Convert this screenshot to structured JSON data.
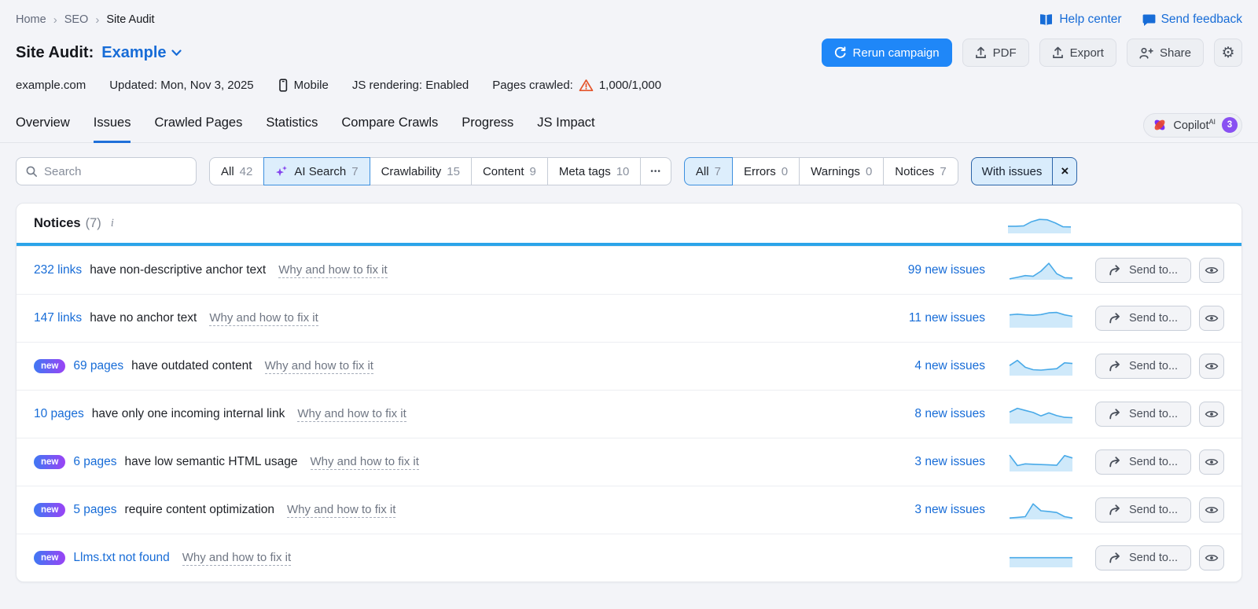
{
  "breadcrumb": {
    "items": [
      "Home",
      "SEO",
      "Site Audit"
    ]
  },
  "header": {
    "help_center": "Help center",
    "send_feedback": "Send feedback",
    "title_prefix": "Site Audit:",
    "campaign_name": "Example",
    "rerun_button": "Rerun campaign",
    "pdf_button": "PDF",
    "export_button": "Export",
    "share_button": "Share"
  },
  "meta": {
    "domain": "example.com",
    "updated": "Updated: Mon, Nov 3, 2025",
    "device": "Mobile",
    "js_rendering": "JS rendering: Enabled",
    "pages_crawled_label": "Pages crawled:",
    "pages_crawled_value": "1,000/1,000"
  },
  "tabs": [
    {
      "label": "Overview",
      "active": false
    },
    {
      "label": "Issues",
      "active": true
    },
    {
      "label": "Crawled Pages",
      "active": false
    },
    {
      "label": "Statistics",
      "active": false
    },
    {
      "label": "Compare Crawls",
      "active": false
    },
    {
      "label": "Progress",
      "active": false
    },
    {
      "label": "JS Impact",
      "active": false
    }
  ],
  "copilot": {
    "label": "Copilot",
    "superscript": "AI",
    "badge": "3"
  },
  "filters": {
    "search_placeholder": "Search",
    "more_label": "•••",
    "category_chips": [
      {
        "label": "All",
        "count": "42",
        "selected": false
      },
      {
        "label": "AI Search",
        "count": "7",
        "selected": true
      },
      {
        "label": "Crawlability",
        "count": "15",
        "selected": false
      },
      {
        "label": "Content",
        "count": "9",
        "selected": false
      },
      {
        "label": "Meta tags",
        "count": "10",
        "selected": false
      }
    ],
    "severity_chips": [
      {
        "label": "All",
        "count": "7",
        "selected": true
      },
      {
        "label": "Errors",
        "count": "0",
        "selected": false
      },
      {
        "label": "Warnings",
        "count": "0",
        "selected": false
      },
      {
        "label": "Notices",
        "count": "7",
        "selected": false
      }
    ],
    "with_issues_label": "With issues",
    "with_issues_close": "×"
  },
  "notices": {
    "title": "Notices",
    "count": "(7)",
    "trend": [
      38,
      38,
      40,
      62,
      74,
      72,
      56,
      35,
      34
    ]
  },
  "row_actions": {
    "send_to": "Send to..."
  },
  "rows": [
    {
      "badge": null,
      "link": "232 links",
      "text": "have non-descriptive anchor text",
      "fix": "Why and how to fix it",
      "issues": "99 new issues",
      "trend": [
        5,
        14,
        24,
        20,
        50,
        95,
        35,
        12,
        10
      ]
    },
    {
      "badge": null,
      "link": "147 links",
      "text": "have no anchor text",
      "fix": "Why and how to fix it",
      "issues": "11 new issues",
      "trend": [
        74,
        78,
        74,
        72,
        76,
        86,
        88,
        74,
        66
      ]
    },
    {
      "badge": "new",
      "link": "69 pages",
      "text": "have outdated content",
      "fix": "Why and how to fix it",
      "issues": "4 new issues",
      "trend": [
        58,
        88,
        48,
        34,
        32,
        36,
        40,
        74,
        70
      ]
    },
    {
      "badge": null,
      "link": "10 pages",
      "text": "have only one incoming internal link",
      "fix": "Why and how to fix it",
      "issues": "8 new issues",
      "trend": [
        66,
        88,
        76,
        64,
        44,
        62,
        46,
        36,
        34
      ]
    },
    {
      "badge": "new",
      "link": "6 pages",
      "text": "have low semantic HTML usage",
      "fix": "Why and how to fix it",
      "issues": "3 new issues",
      "trend": [
        95,
        34,
        44,
        42,
        40,
        38,
        36,
        92,
        78
      ]
    },
    {
      "badge": "new",
      "link": "5 pages",
      "text": "require content optimization",
      "fix": "Why and how to fix it",
      "issues": "3 new issues",
      "trend": [
        8,
        12,
        16,
        90,
        50,
        46,
        40,
        16,
        8
      ]
    },
    {
      "badge": "new",
      "link": "Llms.txt not found",
      "text": "",
      "fix": "Why and how to fix it",
      "issues": "",
      "trend": [
        56,
        56,
        56,
        56,
        56,
        56,
        56,
        56,
        56
      ]
    }
  ]
}
